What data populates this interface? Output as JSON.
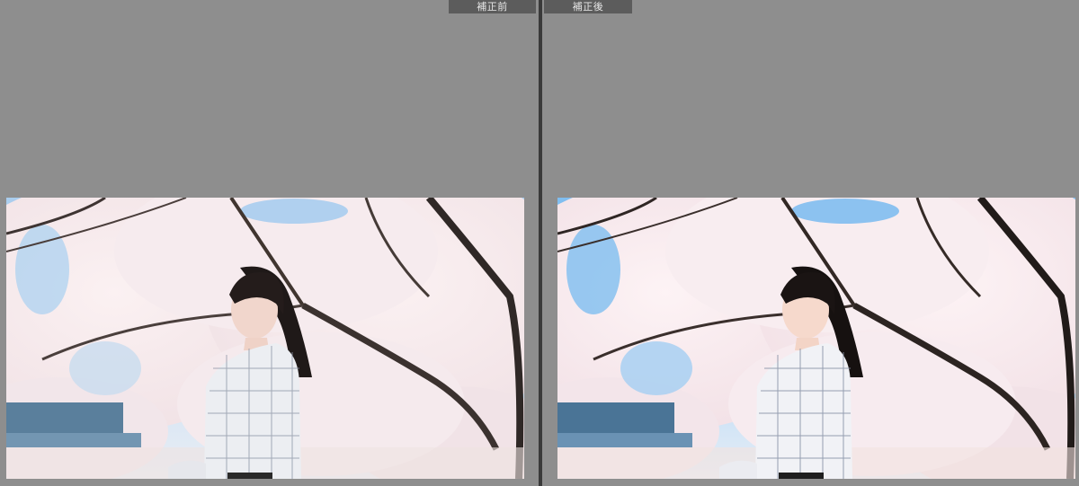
{
  "left_pane": {
    "label": "補正前"
  },
  "right_pane": {
    "label": "補正後"
  },
  "colors": {
    "background": "#8e8e8e",
    "divider": "#3a3a3a",
    "label_bg": "#5c5c5c",
    "label_text": "#e8e8e8",
    "sky_before": "#bcd8ef",
    "sky_after": "#8cc6f0"
  }
}
